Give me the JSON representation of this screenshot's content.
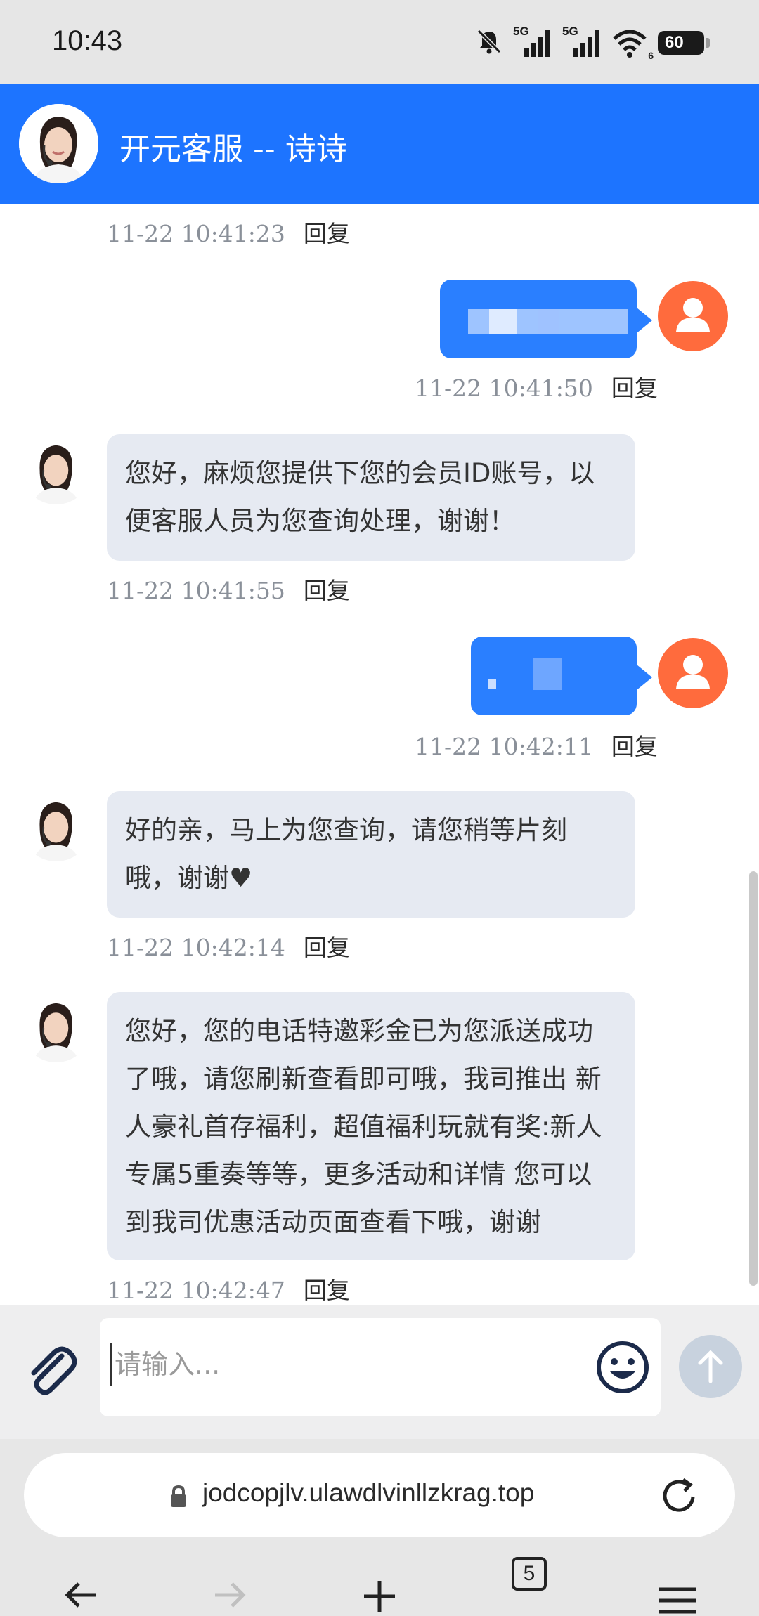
{
  "status_bar": {
    "time": "10:43",
    "signal1": "5G",
    "signal2": "5G",
    "wifi_badge": "6",
    "battery": "60"
  },
  "header": {
    "title": "开元客服 -- 诗诗"
  },
  "messages": [
    {
      "side": "in",
      "timestamp": "11-22 10:41:23",
      "reply": "回复"
    },
    {
      "side": "out",
      "timestamp": "11-22 10:41:50",
      "reply": "回复"
    },
    {
      "side": "in",
      "text": "您好，麻烦您提供下您的会员ID账号，以便客服人员为您查询处理，谢谢！",
      "timestamp": "11-22 10:41:55",
      "reply": "回复"
    },
    {
      "side": "out",
      "timestamp": "11-22 10:42:11",
      "reply": "回复"
    },
    {
      "side": "in",
      "text": "好的亲，马上为您查询，请您稍等片刻哦，谢谢♥",
      "timestamp": "11-22 10:42:14",
      "reply": "回复"
    },
    {
      "side": "in",
      "text": "您好，您的电话特邀彩金已为您派送成功了哦，请您刷新查看即可哦，我司推出 新人豪礼首存福利，超值福利玩就有奖:新人专属5重奏等等，更多活动和详情 您可以到我司优惠活动页面查看下哦，谢谢",
      "timestamp": "11-22 10:42:47",
      "reply": "回复"
    }
  ],
  "input": {
    "placeholder": "请输入..."
  },
  "browser": {
    "url": "jodcopjlv.ulawdlvinllzkrag.top",
    "tab_count": "5"
  },
  "colors": {
    "header": "#1d74ff",
    "bubble_in": "#e6eaf2",
    "bubble_out": "#2a7fff",
    "user_avatar": "#ff6b3d"
  }
}
